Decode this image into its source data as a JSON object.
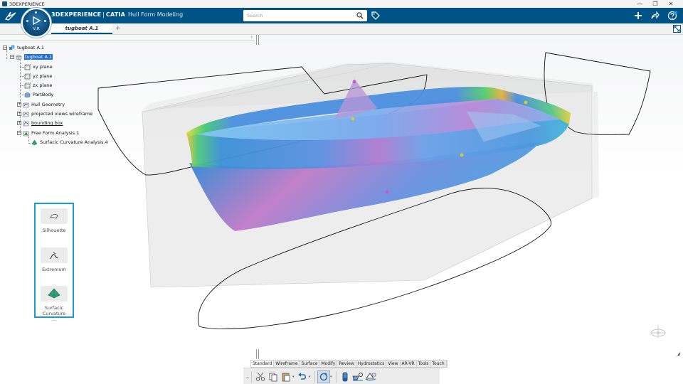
{
  "os_window": {
    "title": "3DEXPERIENCE",
    "controls": [
      "—",
      "❐",
      "✕"
    ]
  },
  "topbar": {
    "brand_strong": "3DEXPERIENCE",
    "brand_separator": "|",
    "brand_product": "CATIA",
    "app_name": "Hull Form Modeling",
    "search_placeholder": "Search",
    "accent_color": "#005386"
  },
  "compass": {
    "label": "V,R"
  },
  "tabs": {
    "document_tab": "tugboat A.1",
    "add_tab": "+"
  },
  "tree": {
    "collapse_chevron": "‹",
    "root": "tugboat A.1",
    "product": "tugboat A.1",
    "items": [
      {
        "label": "xy plane",
        "icon": "plane-icon"
      },
      {
        "label": "yz plane",
        "icon": "plane-icon"
      },
      {
        "label": "zx plane",
        "icon": "plane-icon"
      },
      {
        "label": "PartBody",
        "icon": "body-icon"
      },
      {
        "label": "Hull Geometry",
        "icon": "geoset-icon"
      },
      {
        "label": "projected views wireframe",
        "icon": "geoset-icon"
      },
      {
        "label": "bounding box",
        "icon": "geoset-icon"
      },
      {
        "label": "Free Form Analysis.1",
        "icon": "analysis-set-icon"
      },
      {
        "label": "Surfacic Curvature Analysis.4",
        "icon": "curvature-analysis-icon"
      }
    ]
  },
  "action_bar": {
    "buttons": [
      {
        "label": "Silhouette",
        "icon": "silhouette-icon"
      },
      {
        "label": "Extremum",
        "icon": "extremum-icon"
      },
      {
        "label": "Surfacic Curvature ...",
        "icon": "surfacic-curvature-icon"
      }
    ],
    "highlight_color": "#1a9be0"
  },
  "section_tabs": {
    "items": [
      "Standard",
      "Wireframe",
      "Surface",
      "Modify",
      "Review",
      "Hydrostatics",
      "View",
      "AR-VR",
      "Tools",
      "Touch"
    ],
    "active": "Standard"
  },
  "toolbar": {
    "collapse": "⌄",
    "buttons": [
      "cut-icon",
      "copy-icon",
      "paste-icon",
      "undo-icon",
      "update-icon",
      "hydrostatic-tank-icon",
      "hydrostatic-analysis-icon",
      "hydrostatic-results-icon"
    ]
  }
}
